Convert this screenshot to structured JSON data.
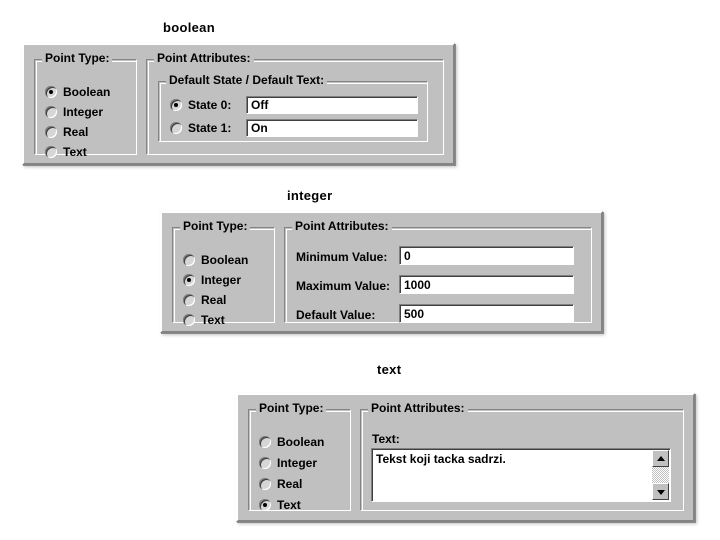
{
  "page": {
    "background": "#ffffff",
    "face_color": "#c0c0c0",
    "field_color": "#ffffff",
    "text_color": "#000000"
  },
  "dialogs": [
    {
      "caption": "boolean",
      "point_type": {
        "legend": "Point Type:",
        "options": [
          {
            "label": "Boolean",
            "selected": true
          },
          {
            "label": "Integer",
            "selected": false
          },
          {
            "label": "Real",
            "selected": false
          },
          {
            "label": "Text",
            "selected": false
          }
        ]
      },
      "point_attributes": {
        "legend": "Point Attributes:",
        "inner_legend": "Default State / Default Text:",
        "states": [
          {
            "radio_label": "State 0:",
            "selected": true,
            "value": "Off"
          },
          {
            "radio_label": "State 1:",
            "selected": false,
            "value": "On"
          }
        ]
      }
    },
    {
      "caption": "integer",
      "point_type": {
        "legend": "Point Type:",
        "options": [
          {
            "label": "Boolean",
            "selected": false
          },
          {
            "label": "Integer",
            "selected": true
          },
          {
            "label": "Real",
            "selected": false
          },
          {
            "label": "Text",
            "selected": false
          }
        ]
      },
      "point_attributes": {
        "legend": "Point Attributes:",
        "fields": [
          {
            "label": "Minimum Value:",
            "value": "0"
          },
          {
            "label": "Maximum Value:",
            "value": "1000"
          },
          {
            "label": "Default Value:",
            "value": "500"
          }
        ]
      }
    },
    {
      "caption": "text",
      "point_type": {
        "legend": "Point Type:",
        "options": [
          {
            "label": "Boolean",
            "selected": false
          },
          {
            "label": "Integer",
            "selected": false
          },
          {
            "label": "Real",
            "selected": false
          },
          {
            "label": "Text",
            "selected": true
          }
        ]
      },
      "point_attributes": {
        "legend": "Point Attributes:",
        "text_label": "Text:",
        "text_value": "Tekst koji tacka sadrzi.",
        "scrollbar": {
          "up_icon": "triangle-up-icon",
          "down_icon": "triangle-down-icon"
        }
      }
    }
  ]
}
